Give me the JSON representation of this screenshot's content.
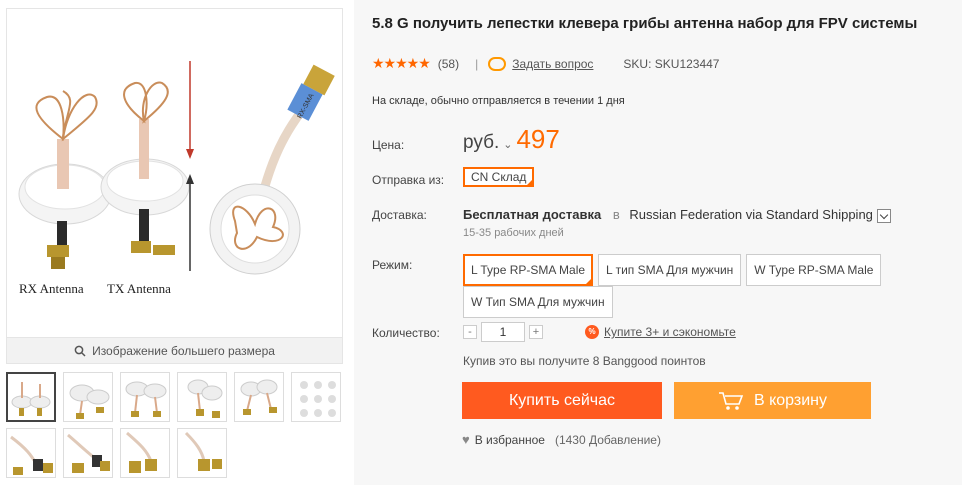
{
  "product": {
    "title": "5.8 G получить лепестки клевера грибы антенна набор для FPV системы",
    "rating_stars": "★★★★★",
    "rating_count": "(58)",
    "separator": "|",
    "ask_question": "Задать вопрос",
    "sku": "SKU: SKU123447",
    "stock_text": "На складе, обычно отправляется в течении 1 дня"
  },
  "gallery": {
    "main_labels": {
      "rx": "RX Antenna",
      "tx": "TX Antenna",
      "cable": "RX-SMA"
    },
    "zoom_label": "Изображение большего размера",
    "thumb_count": 10
  },
  "price": {
    "label": "Цена:",
    "currency": "руб.",
    "arrow": "⌄",
    "value": "497"
  },
  "ship_from": {
    "label": "Отправка из:",
    "option": "CN Склад"
  },
  "delivery": {
    "label": "Доставка:",
    "free": "Бесплатная доставка",
    "in": "в",
    "method": "Russian Federation via Standard Shipping",
    "days": "15-35 рабочих дней"
  },
  "mode": {
    "label": "Режим:",
    "options": [
      "L Type RP-SMA Male",
      "L тип SMA Для мужчин",
      "W Type RP-SMA Male",
      "W Тип SMA Для мужчин"
    ]
  },
  "quantity": {
    "label": "Количество:",
    "minus": "-",
    "value": "1",
    "plus": "+",
    "deal_badge": "%",
    "deal_text": "Купите 3+ и сэкономьте"
  },
  "points_text": "Купив это вы получите 8 Banggood поинтов",
  "buttons": {
    "buy_now": "Купить сейчас",
    "add_to_cart": "В корзину"
  },
  "wishlist": {
    "label": "В избранное",
    "count": "(1430 Добавление)"
  },
  "colors": {
    "accent": "#ff6a00",
    "buy": "#ff5a1f",
    "cart": "#ffa031",
    "panel": "#f7f7f7"
  }
}
